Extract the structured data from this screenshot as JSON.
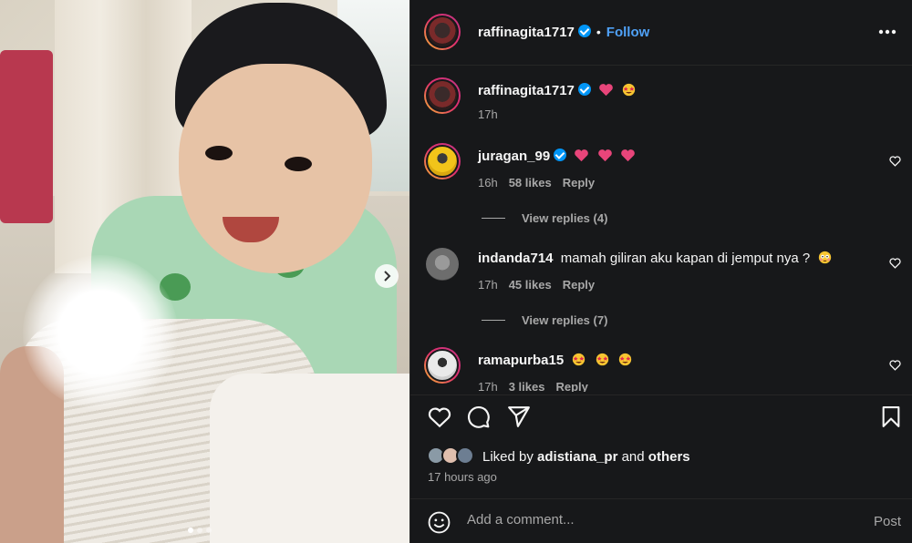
{
  "post": {
    "author": "raffinagita1717",
    "follow_label": "Follow",
    "separator": "•",
    "caption_time": "17h"
  },
  "carousel": {
    "slide_count": 3,
    "active_slide": 1
  },
  "comments": [
    {
      "username": "juragan_99",
      "verified": true,
      "emojis": [
        "heart",
        "heart",
        "heart"
      ],
      "time": "16h",
      "likes": "58 likes",
      "reply": "Reply",
      "view_replies": "View replies (4)"
    },
    {
      "username": "indanda714",
      "text": "mamah giliran aku kapan di jemput nya ?",
      "emojis": [
        "flushed"
      ],
      "time": "17h",
      "likes": "45 likes",
      "reply": "Reply",
      "view_replies": "View replies (7)"
    },
    {
      "username": "ramapurba15",
      "emojis": [
        "star-eyes",
        "star-eyes",
        "star-eyes"
      ],
      "time": "17h",
      "likes": "3 likes",
      "reply": "Reply"
    }
  ],
  "likes": {
    "liked_by_prefix": "Liked by",
    "liked_by_user": "adistiana_pr",
    "and": "and",
    "others": "others",
    "timestamp": "17 hours ago"
  },
  "comment_bar": {
    "placeholder": "Add a comment...",
    "post_label": "Post"
  },
  "colors": {
    "panel_bg": "#17181a",
    "accent_blue": "#0095f6",
    "follow_blue": "#4fa1f7",
    "heart_pink": "#e8457a"
  }
}
